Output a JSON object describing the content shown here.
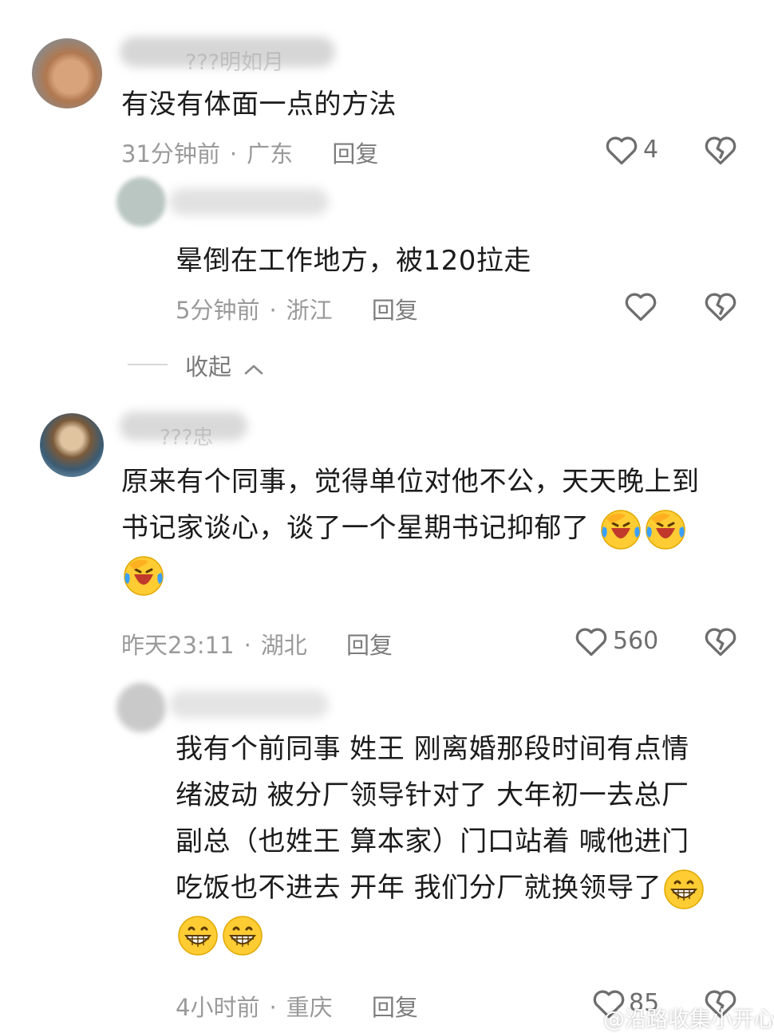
{
  "comments": [
    {
      "username": "???明如月",
      "text": "有没有体面一点的方法",
      "time": "31分钟前",
      "location": "广东",
      "reply_label": "回复",
      "likes": "4",
      "replies": [
        {
          "text": "晕倒在工作地方，被120拉走",
          "time": "5分钟前",
          "location": "浙江",
          "reply_label": "回复"
        }
      ],
      "collapse_label": "收起"
    },
    {
      "username": "???忠",
      "text_line1": "原来有个同事，觉得单位对他不公，天天晚上到",
      "text_line2": "书记家谈心，谈了一个星期书记抑郁了",
      "time": "昨天23:11",
      "location": "湖北",
      "reply_label": "回复",
      "likes": "560",
      "replies": [
        {
          "text_line1": "我有个前同事 姓王 刚离婚那段时间有点情",
          "text_line2": "绪波动 被分厂领导针对了 大年初一去总厂",
          "text_line3": "副总（也姓王 算本家）门口站着 喊他进门",
          "text_line4": "吃饭也不进去 开年 我们分厂就换领导了",
          "time": "4小时前",
          "location": "重庆",
          "reply_label": "回复",
          "likes": "85"
        }
      ]
    }
  ],
  "watermark": "@沿路收集小开心",
  "icons": {
    "like": "heart-outline-icon",
    "dislike": "broken-heart-icon",
    "laugh_cry_emoji": "laughing-crying-emoji",
    "grin_emoji": "grinning-emoji"
  }
}
